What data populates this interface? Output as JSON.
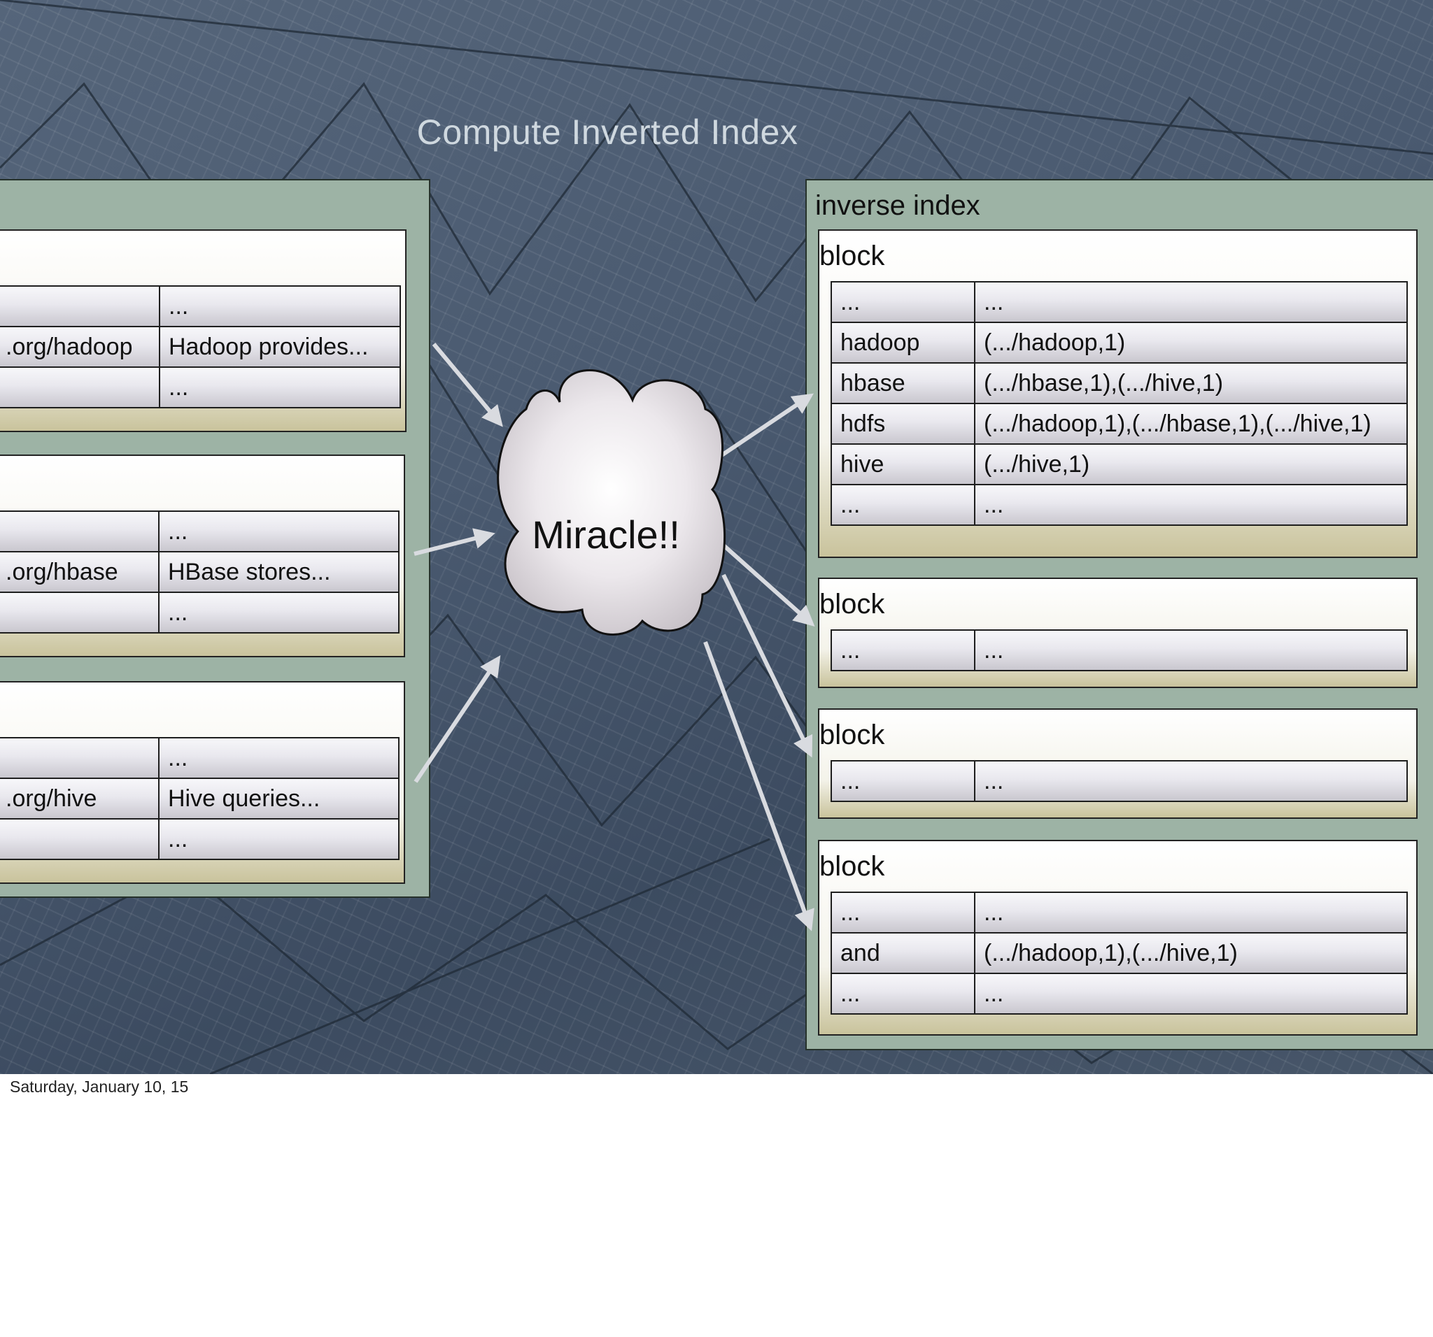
{
  "slide": {
    "title": "Compute Inverted Index",
    "footer_date": "Saturday, January 10, 15"
  },
  "center_node": {
    "label": "Miracle!!"
  },
  "source_documents": [
    {
      "rows": [
        [
          "",
          "..."
        ],
        [
          ".org/hadoop",
          "Hadoop provides..."
        ],
        [
          "",
          "..."
        ]
      ]
    },
    {
      "rows": [
        [
          "",
          "..."
        ],
        [
          ".org/hbase",
          "HBase stores..."
        ],
        [
          "",
          "..."
        ]
      ]
    },
    {
      "rows": [
        [
          "",
          "..."
        ],
        [
          ".org/hive",
          "Hive queries..."
        ],
        [
          "",
          "..."
        ]
      ]
    }
  ],
  "inverse_index": {
    "label": "inverse index",
    "blocks": [
      {
        "label": "block",
        "rows": [
          [
            "...",
            "..."
          ],
          [
            "hadoop",
            "(.../hadoop,1)"
          ],
          [
            "hbase",
            "(.../hbase,1),(.../hive,1)"
          ],
          [
            "hdfs",
            "(.../hadoop,1),(.../hbase,1),(.../hive,1)"
          ],
          [
            "hive",
            "(.../hive,1)"
          ],
          [
            "...",
            "..."
          ]
        ]
      },
      {
        "label": "block",
        "rows": [
          [
            "...",
            "..."
          ]
        ]
      },
      {
        "label": "block",
        "rows": [
          [
            "...",
            "..."
          ]
        ]
      },
      {
        "label": "block",
        "rows": [
          [
            "...",
            "..."
          ],
          [
            "and",
            "(.../hadoop,1),(.../hive,1)"
          ],
          [
            "...",
            "..."
          ]
        ]
      }
    ]
  },
  "colors": {
    "panel": "#9db3a5",
    "arrow": "#d9dbe0",
    "cloud": "#e7e3e7",
    "title": "#cfd8df"
  }
}
